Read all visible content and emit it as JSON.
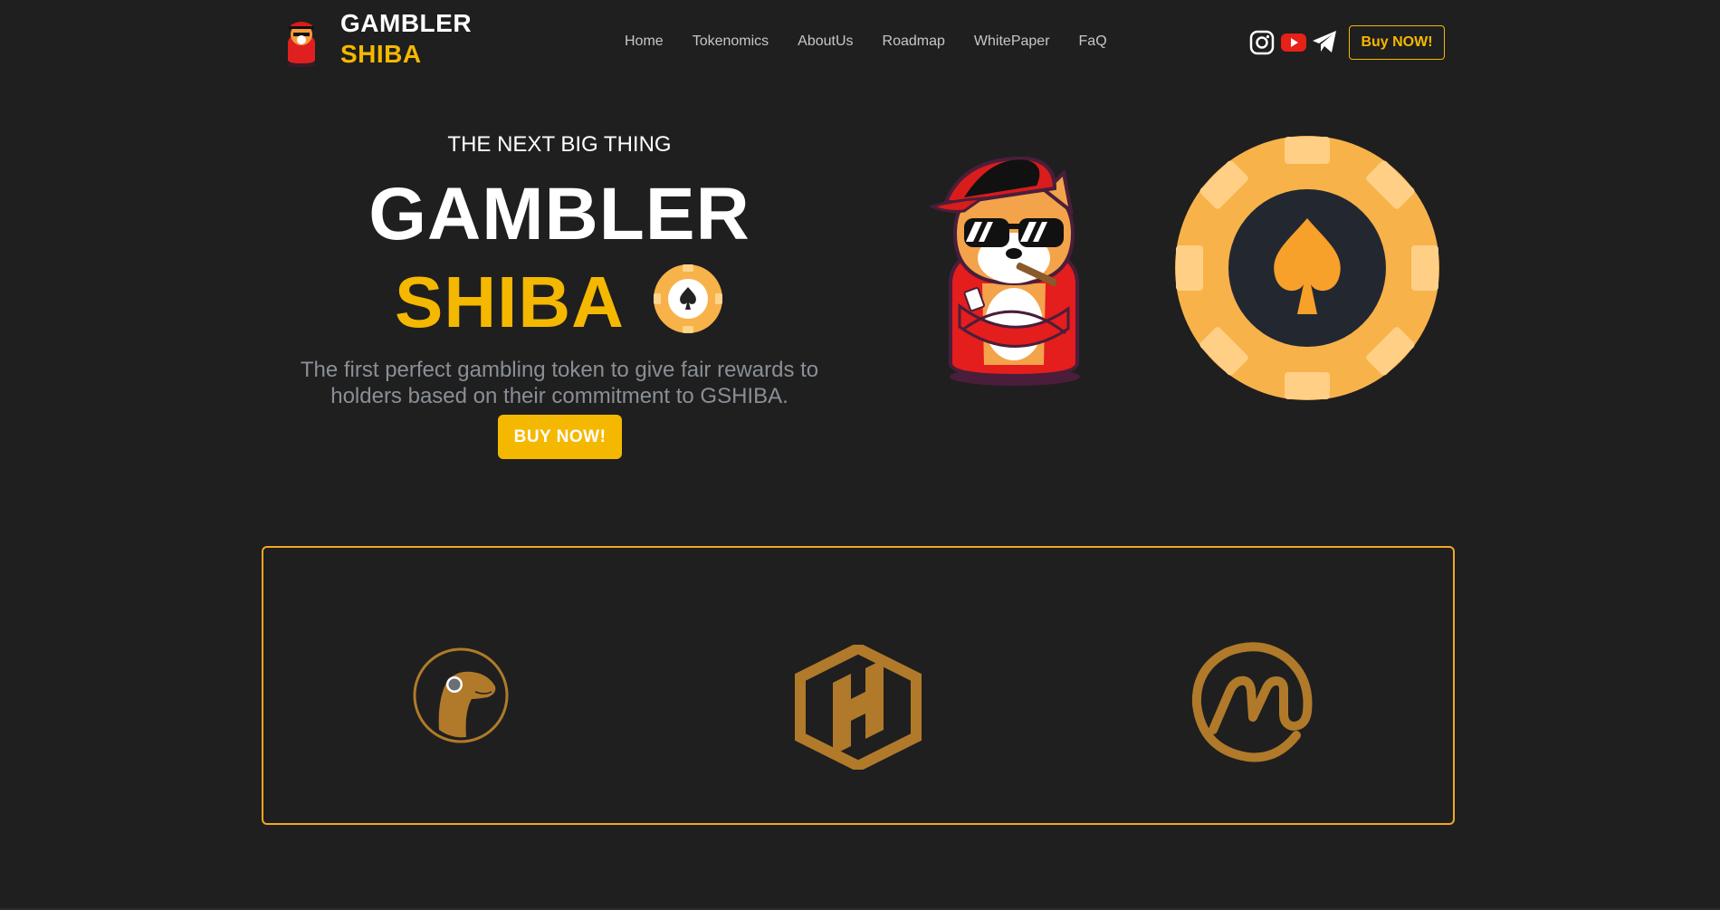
{
  "header": {
    "brand_line1": "GAMBLER",
    "brand_line2": "SHIBA",
    "nav": [
      "Home",
      "Tokenomics",
      "AboutUs",
      "Roadmap",
      "WhitePaper",
      "FaQ"
    ],
    "social_icons": [
      "instagram-icon",
      "youtube-icon",
      "telegram-icon"
    ],
    "buy_button": "Buy NOW!"
  },
  "hero": {
    "subtitle": "THE NEXT BIG THING",
    "title_line1": "GAMBLER",
    "title_line2": "SHIBA",
    "description_line1": "The first perfect gambling token to give fair rewards to",
    "description_line2": "holders based on their commitment to GSHIBA.",
    "buy_button": "BUY NOW!"
  },
  "partners": [
    "coingecko-logo",
    "hotbit-logo",
    "coinmarketcap-logo"
  ],
  "colors": {
    "background": "#1f1f1f",
    "accent": "#f5b800",
    "partner_border": "#f5a623",
    "partner_logo": "#b07a2a",
    "chip_outer": "#f8b24a",
    "chip_center": "#232830"
  }
}
